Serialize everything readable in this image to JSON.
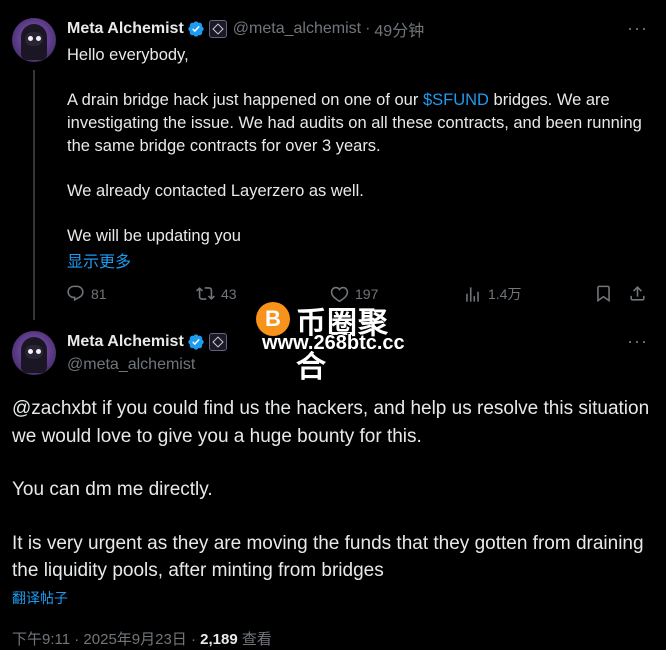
{
  "tweet1": {
    "display_name": "Meta Alchemist",
    "handle": "@meta_alchemist",
    "separator": "·",
    "time_ago": "49分钟",
    "more": "···",
    "greeting": "Hello everybody,",
    "para1_pre": "A drain bridge hack just happened on one of our ",
    "cashtag": "$SFUND",
    "para1_post": " bridges. We are investigating the issue. We had audits on all these contracts, and been running the same bridge contracts for over 3 years.",
    "para2": "We already contacted Layerzero as well.",
    "para3": "We will be updating you",
    "show_more": "显示更多",
    "replies": "81",
    "reposts": "43",
    "likes": "197",
    "views": "1.4万"
  },
  "watermark": {
    "coin_symbol": "B",
    "chinese": "币圈聚合",
    "url": "www.268btc.cc"
  },
  "tweet2": {
    "display_name": "Meta Alchemist",
    "handle": "@meta_alchemist",
    "more": "···",
    "para1": "@zachxbt if you could find us the hackers, and help us resolve this situation we would love to give you a huge bounty for this.",
    "para2": "You can dm me directly.",
    "para3": "It is very urgent as they are moving the funds that they gotten from draining the liquidity pools, after minting from bridges",
    "translate": "翻译帖子",
    "timestamp": "下午9:11 · 2025年9月23日 · ",
    "view_count": "2,189",
    "views_label": " 查看"
  },
  "colors": {
    "background": "#000000",
    "text": "#e7e9ea",
    "muted": "#71767b",
    "link": "#1d9bf0",
    "verified": "#1d9bf0"
  }
}
